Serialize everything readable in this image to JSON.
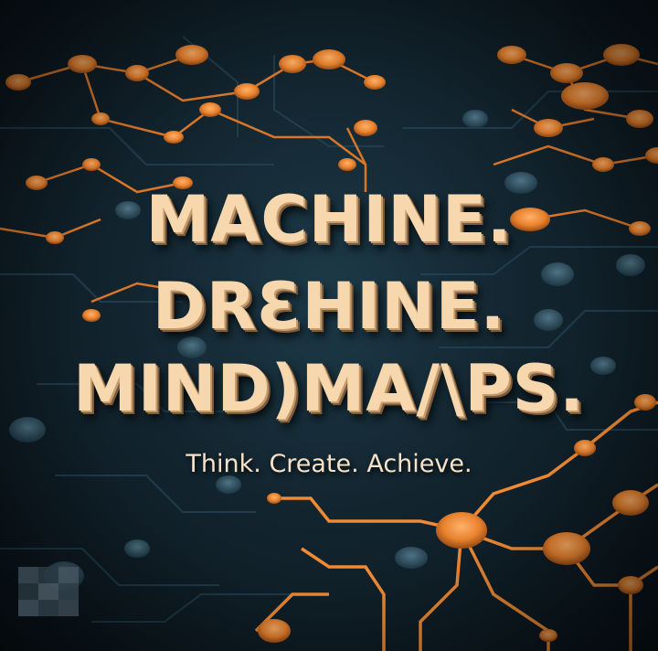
{
  "headline": {
    "line1": "MACHINE.",
    "line2": "DRƐHINE.",
    "line3": "MIND)MA/\\PS."
  },
  "tagline": "Think. Create. Achieve.",
  "colors": {
    "background": "#12242e",
    "circuit_orange": "#e8822e",
    "circuit_dark": "#2a4a5a",
    "headline_text": "#f7d7ae",
    "tagline_text": "#f5e2c8"
  },
  "icons": [
    "circuit-board-background",
    "pixelated-censor-patch"
  ]
}
